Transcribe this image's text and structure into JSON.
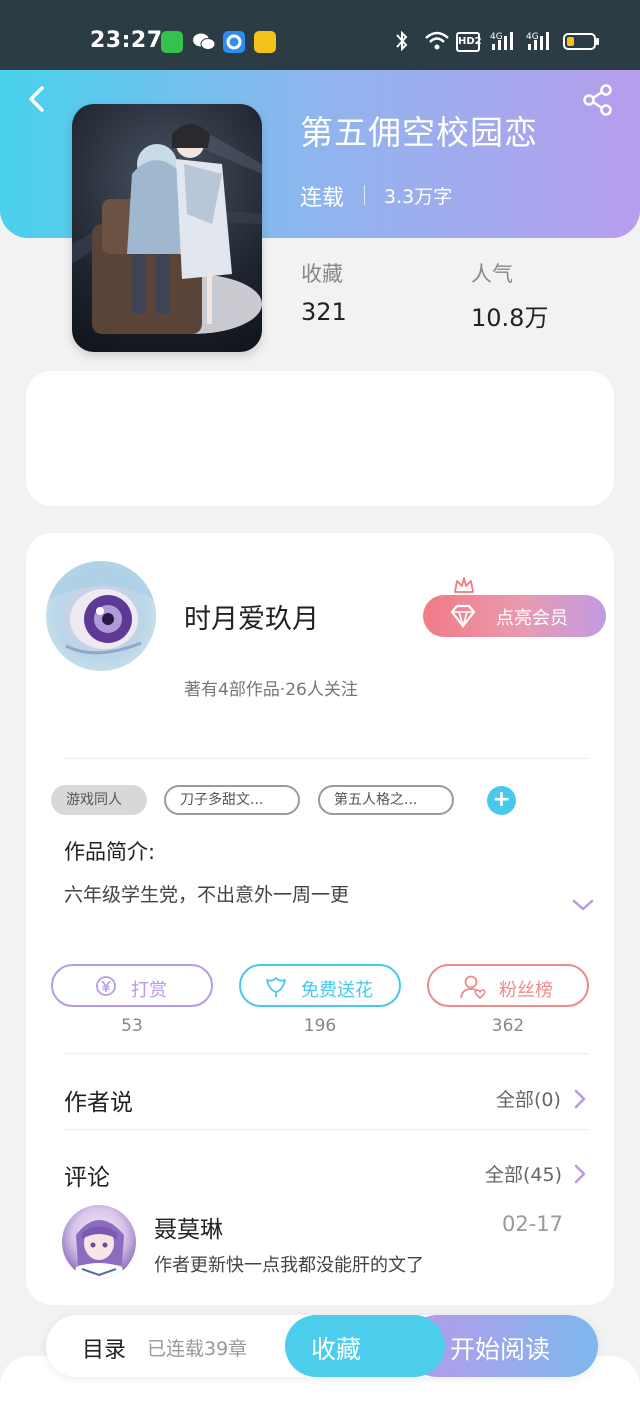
{
  "status_bar": {
    "time": "23:27",
    "network": "4G",
    "hd": "HD2"
  },
  "book": {
    "title": "第五佣空校园恋",
    "status": "连载",
    "word_count": "3.3万字",
    "stats": {
      "favorites_label": "收藏",
      "favorites_value": "321",
      "popularity_label": "人气",
      "popularity_value": "10.8万"
    }
  },
  "author": {
    "name": "时月爱玖月",
    "meta": "著有4部作品·26人关注",
    "vip_button": "点亮会员"
  },
  "tags": [
    "游戏同人",
    "刀子多甜文...",
    "第五人格之..."
  ],
  "tag_add": "+",
  "intro": {
    "label": "作品简介:",
    "text": "六年级学生党，不出意外一周一更"
  },
  "actions": [
    {
      "label": "打赏",
      "count": "53",
      "icon": "yen-coin-icon",
      "color": "#b79ae8"
    },
    {
      "label": "免费送花",
      "count": "196",
      "icon": "flower-icon",
      "color": "#47c8ec"
    },
    {
      "label": "粉丝榜",
      "count": "362",
      "icon": "fans-user-icon",
      "color": "#ee8a8a"
    }
  ],
  "author_says": {
    "title": "作者说",
    "link": "全部(0)"
  },
  "comments": {
    "title": "评论",
    "link": "全部(45)",
    "items": [
      {
        "name": "聂莫琳",
        "date": "02-17",
        "text": "作者更新快一点我都没能肝的文了"
      }
    ]
  },
  "bottom_bar": {
    "toc": "目录",
    "chapters": "已连载39章",
    "collect": "收藏",
    "read": "开始阅读"
  },
  "colors": {
    "accent_cyan": "#47c8ec",
    "accent_purple": "#b79ae8",
    "accent_pink": "#f27a86"
  }
}
